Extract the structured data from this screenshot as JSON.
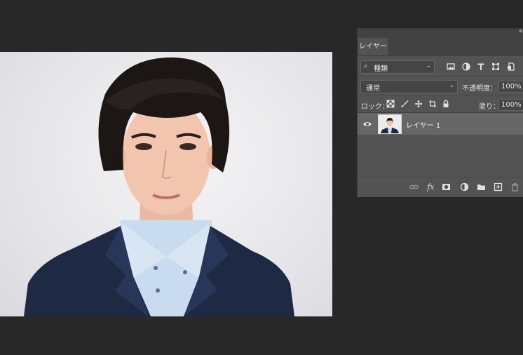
{
  "panel": {
    "collapse_glyph": "«",
    "tab_label": "レイヤー",
    "filter": {
      "search_glyph": "⌕",
      "kind_label": "種類",
      "chevron": "⌄"
    },
    "blend_mode": "通常",
    "opacity_label": "不透明度：",
    "opacity_value": "100%",
    "lock_label": "ロック：",
    "fill_label": "塗り：",
    "fill_value": "100%",
    "layers": [
      {
        "name": "レイヤー 1",
        "visible": true,
        "selected": true
      }
    ]
  },
  "filter_icons": [
    "image-filter-icon",
    "adjustment-filter-icon",
    "type-filter-icon",
    "shape-filter-icon",
    "smart-object-filter-icon"
  ],
  "lock_icons": [
    "lock-transparent-pixels-icon",
    "lock-image-pixels-icon",
    "lock-position-icon",
    "lock-artboard-icon",
    "lock-all-icon"
  ],
  "bottom_icons": [
    "link-layers-icon",
    "fx-icon",
    "add-mask-icon",
    "new-adjustment-layer-icon",
    "new-group-icon",
    "new-layer-icon",
    "delete-layer-icon"
  ],
  "colors": {
    "app_background": "#282828",
    "panel_background": "#535353",
    "selected_layer": "#666666",
    "suit": "#1e2a44",
    "shirt": "#c6d9ec"
  }
}
